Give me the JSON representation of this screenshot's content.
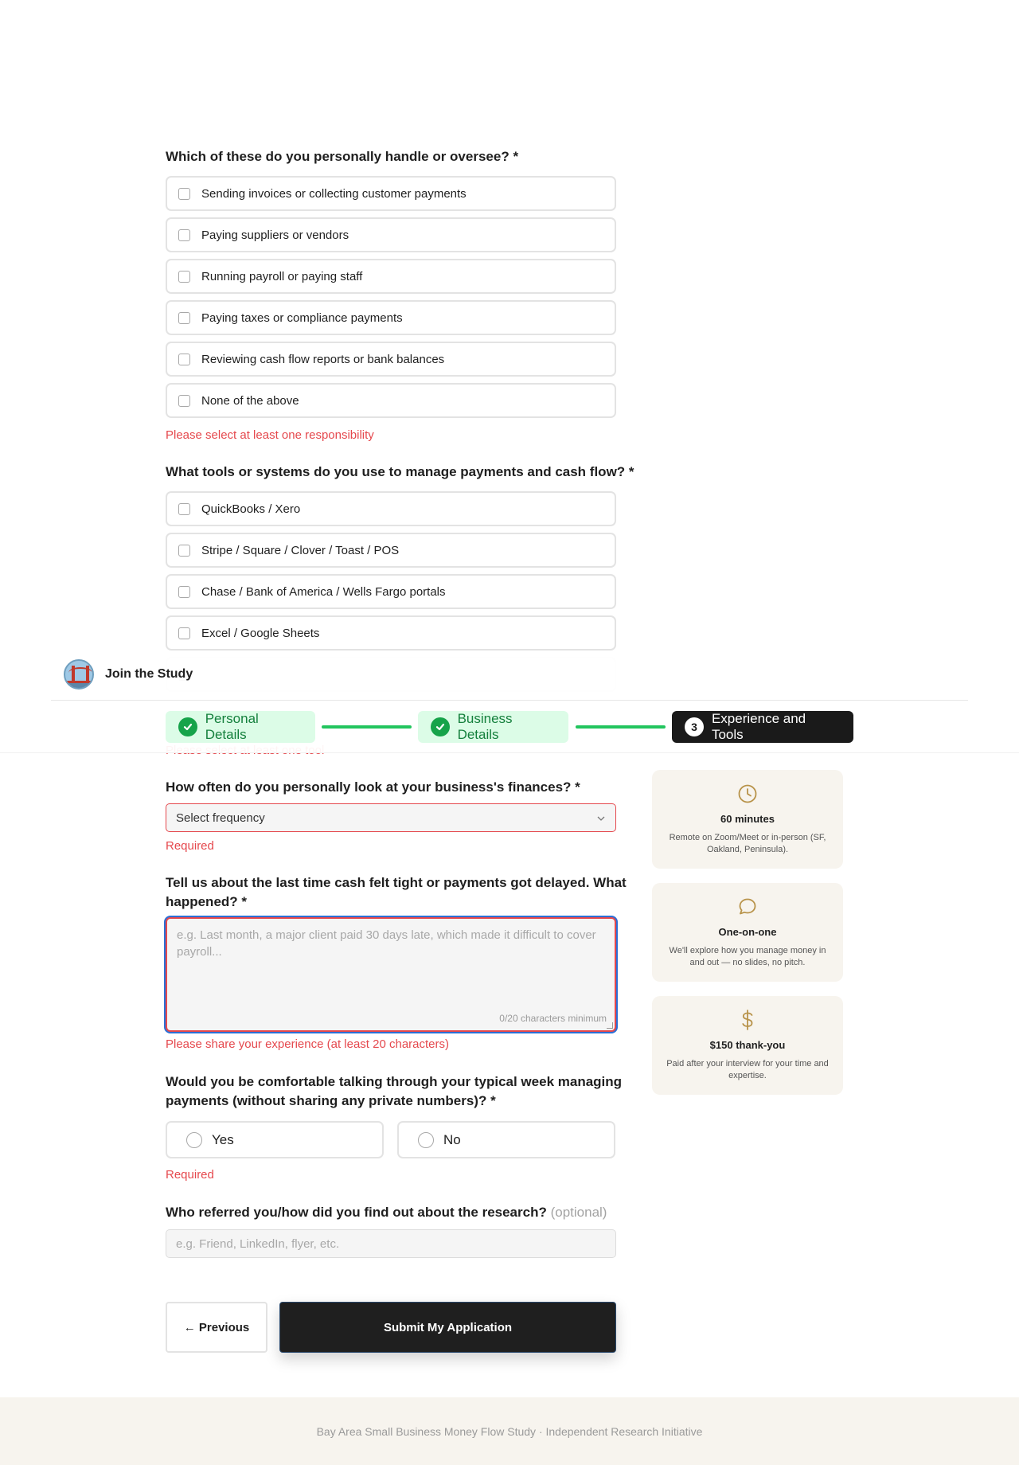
{
  "responsibilities": {
    "question": "Which of these do you personally handle or oversee?",
    "required_mark": "*",
    "options": [
      "Sending invoices or collecting customer payments",
      "Paying suppliers or vendors",
      "Running payroll or paying staff",
      "Paying taxes or compliance payments",
      "Reviewing cash flow reports or bank balances",
      "None of the above"
    ],
    "error": "Please select at least one responsibility"
  },
  "tools": {
    "question": "What tools or systems do you use to manage payments and cash flow?",
    "required_mark": "*",
    "options": [
      "QuickBooks / Xero",
      "Stripe / Square / Clover / Toast / POS",
      "Chase / Bank of America / Wells Fargo portals",
      "Excel / Google Sheets"
    ],
    "error": "Please select at least one tool"
  },
  "header": {
    "brand": "Join the Study",
    "steps": [
      {
        "label": "Personal Details",
        "state": "done"
      },
      {
        "label": "Business Details",
        "state": "done"
      },
      {
        "label": "Experience and Tools",
        "state": "active",
        "number": "3"
      }
    ]
  },
  "frequency": {
    "question": "How often do you personally look at your business's finances?",
    "required_mark": "*",
    "placeholder": "Select frequency",
    "error": "Required"
  },
  "experience": {
    "question": "Tell us about the last time cash felt tight or payments got delayed. What happened?",
    "required_mark": "*",
    "placeholder": "e.g. Last month, a major client paid 30 days late, which made it difficult to cover payroll...",
    "counter": "0/20 characters minimum",
    "error": "Please share your experience (at least 20 characters)"
  },
  "comfort": {
    "question": "Would you be comfortable talking through your typical week managing payments (without sharing any private numbers)?",
    "required_mark": "*",
    "options": [
      "Yes",
      "No"
    ],
    "error": "Required"
  },
  "referral": {
    "question": "Who referred you/how did you find out about the research?",
    "optional": "(optional)",
    "placeholder": "e.g. Friend, LinkedIn, flyer, etc."
  },
  "buttons": {
    "previous": "← Previous",
    "submit": "Submit My Application"
  },
  "info_cards": [
    {
      "icon": "clock-icon",
      "title": "60 minutes",
      "desc": "Remote on Zoom/Meet or in-person (SF, Oakland, Peninsula)."
    },
    {
      "icon": "chat-bubble-icon",
      "title": "One-on-one",
      "desc": "We'll explore how you manage money in and out — no slides, no pitch."
    },
    {
      "icon": "dollar-icon",
      "title": "$150 thank-you",
      "desc": "Paid after your interview for your time and expertise."
    }
  ],
  "footer": "Bay Area Small Business Money Flow Study · Independent Research Initiative",
  "colors": {
    "accent_green": "#22c55e",
    "error_red": "#e5484d",
    "card_bg": "#f7f4ee",
    "icon_gold": "#b8934a"
  }
}
